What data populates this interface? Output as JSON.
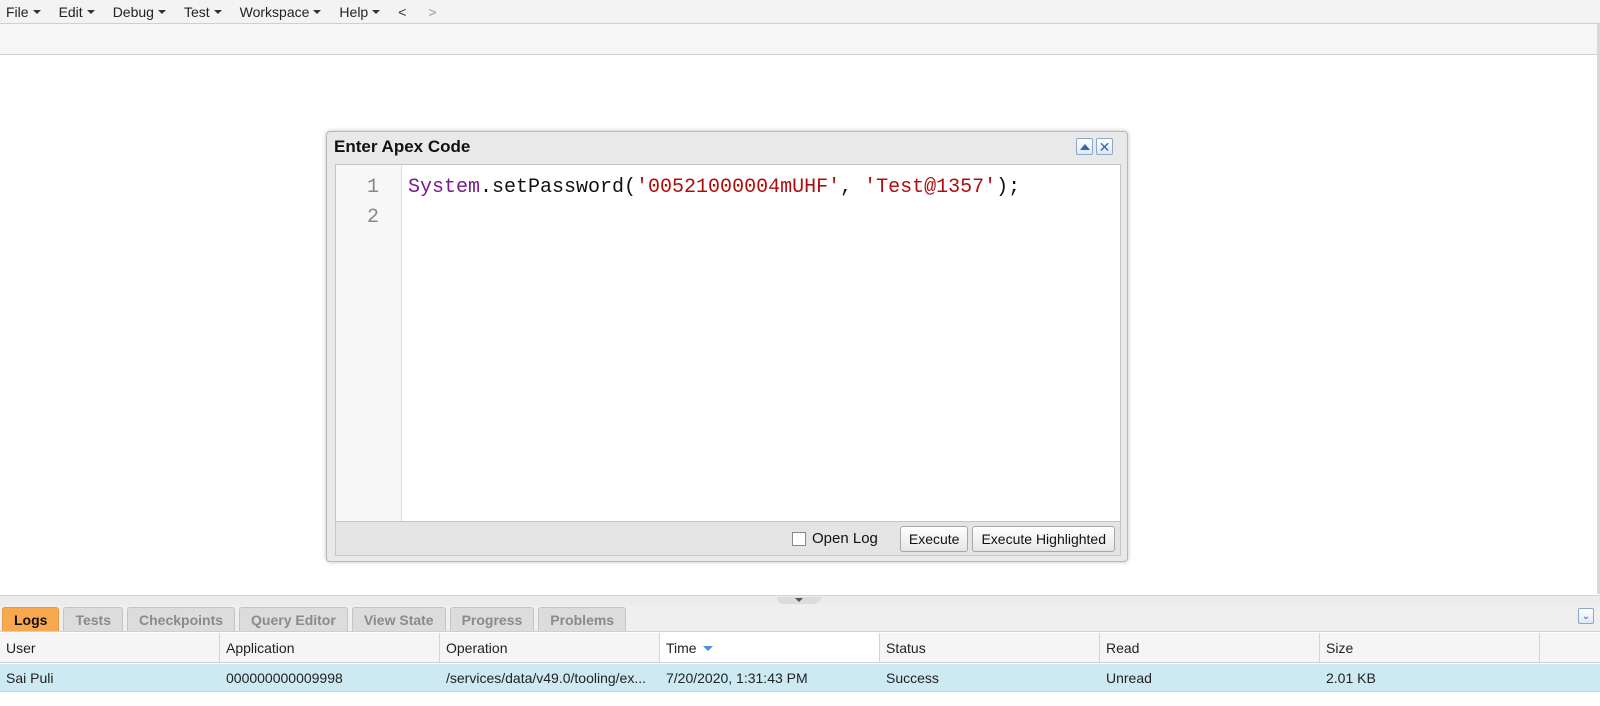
{
  "menubar": {
    "items": [
      {
        "label": "File"
      },
      {
        "label": "Edit"
      },
      {
        "label": "Debug"
      },
      {
        "label": "Test"
      },
      {
        "label": "Workspace"
      },
      {
        "label": "Help"
      }
    ],
    "back": "<",
    "forward": ">"
  },
  "dialog": {
    "title": "Enter Apex Code",
    "collapse_icon": "triangle-up-icon",
    "close_icon": "close-icon",
    "editor": {
      "line_numbers": [
        "1",
        "2"
      ],
      "line1": {
        "class_token": "System",
        "method": ".setPassword(",
        "arg1": "'00521000004mUHF'",
        "sep": ", ",
        "arg2": "'Test@1357'",
        "end": ");"
      }
    },
    "footer": {
      "open_log_label": "Open Log",
      "open_log_checked": false,
      "execute_label": "Execute",
      "execute_highlighted_label": "Execute Highlighted"
    }
  },
  "tabs": [
    {
      "label": "Logs",
      "active": true
    },
    {
      "label": "Tests"
    },
    {
      "label": "Checkpoints"
    },
    {
      "label": "Query Editor"
    },
    {
      "label": "View State"
    },
    {
      "label": "Progress"
    },
    {
      "label": "Problems"
    }
  ],
  "logs_table": {
    "columns": [
      "User",
      "Application",
      "Operation",
      "Time",
      "Status",
      "Read",
      "Size"
    ],
    "sorted_column": "Time",
    "rows": [
      {
        "user": "Sai Puli",
        "application": "000000000009998",
        "operation": "/services/data/v49.0/tooling/ex...",
        "time": "7/20/2020, 1:31:43 PM",
        "status": "Success",
        "read": "Unread",
        "size": "2.01 KB"
      }
    ]
  },
  "colors": {
    "active_tab": "#f8a84f",
    "selected_row": "#cdeaf2",
    "class_token": "#7a1a8c",
    "string_token": "#b00d0d"
  }
}
